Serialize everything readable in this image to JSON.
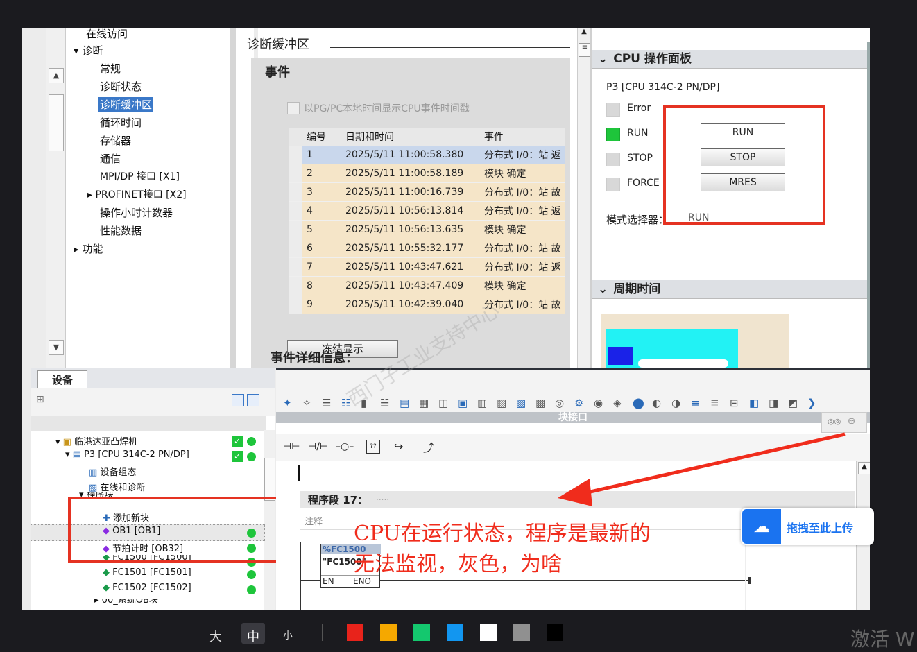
{
  "nav": {
    "items": [
      "在线访问",
      "诊断",
      "常规",
      "诊断状态",
      "诊断缓冲区",
      "循环时间",
      "存储器",
      "通信",
      "MPI/DP 接口 [X1]",
      "PROFINET接口 [X2]",
      "操作小时计数器",
      "性能数据",
      "功能"
    ]
  },
  "diag": {
    "title": "诊断缓冲区",
    "events_heading": "事件",
    "checkbox_label": "以PG/PC本地时间显示CPU事件时间戳",
    "columns": [
      "编号",
      "日期和时间",
      "事件"
    ],
    "rows": [
      {
        "no": "1",
        "time": "2025/5/11 11:00:58.380",
        "event": "分布式 I/0：站 返"
      },
      {
        "no": "2",
        "time": "2025/5/11 11:00:58.189",
        "event": "模块 确定"
      },
      {
        "no": "3",
        "time": "2025/5/11 11:00:16.739",
        "event": "分布式 I/0：站 故"
      },
      {
        "no": "4",
        "time": "2025/5/11 10:56:13.814",
        "event": "分布式 I/0：站 返"
      },
      {
        "no": "5",
        "time": "2025/5/11 10:56:13.635",
        "event": "模块 确定"
      },
      {
        "no": "6",
        "time": "2025/5/11 10:55:32.177",
        "event": "分布式 I/0：站 故"
      },
      {
        "no": "7",
        "time": "2025/5/11 10:43:47.621",
        "event": "分布式 I/0：站 返"
      },
      {
        "no": "8",
        "time": "2025/5/11 10:43:47.409",
        "event": "模块 确定"
      },
      {
        "no": "9",
        "time": "2025/5/11 10:42:39.040",
        "event": "分布式 I/0：站 故"
      }
    ],
    "freeze_button": "冻结显示",
    "details_heading": "事件详细信息："
  },
  "cpu": {
    "panel_title": "CPU 操作面板",
    "device": "P3 [CPU 314C-2 PN/DP]",
    "leds": [
      "Error",
      "RUN",
      "STOP",
      "FORCE"
    ],
    "buttons": [
      "RUN",
      "STOP",
      "MRES"
    ],
    "mode_label": "模式选择器：",
    "mode_value": "RUN",
    "cycle_title": "周期时间"
  },
  "devices": {
    "tab": "设备",
    "tree": [
      "临港达亚凸焊机",
      "P3 [CPU 314C-2 PN/DP]",
      "设备组态",
      "在线和诊断",
      "程序块",
      "添加新块",
      "OB1 [OB1]",
      "节拍计时 [OB32]",
      "FC1500 [FC1500]",
      "FC1501 [FC1501]",
      "FC1502 [FC1502]",
      "00_系统OB块"
    ]
  },
  "editor": {
    "block_interface": "块接口",
    "network": "程序段 17：",
    "network_dots": ".....",
    "comment": "注释",
    "fc_addr": "%FC1500",
    "fc_name": "\"FC1500\"",
    "en": "EN",
    "eno": "ENO",
    "annotation_line1": "CPU在运行状态，程序是最新的",
    "annotation_line2": "无法监视，灰色，为啥",
    "upload_button": "拖拽至此上传"
  },
  "bottom": {
    "sizes": [
      "大",
      "中",
      "小"
    ],
    "watermark": "激活 W",
    "colors": [
      "#e8231b",
      "#f5a800",
      "#14c86e",
      "#1296f0",
      "#ffffff",
      "#909090",
      "#000000"
    ]
  }
}
